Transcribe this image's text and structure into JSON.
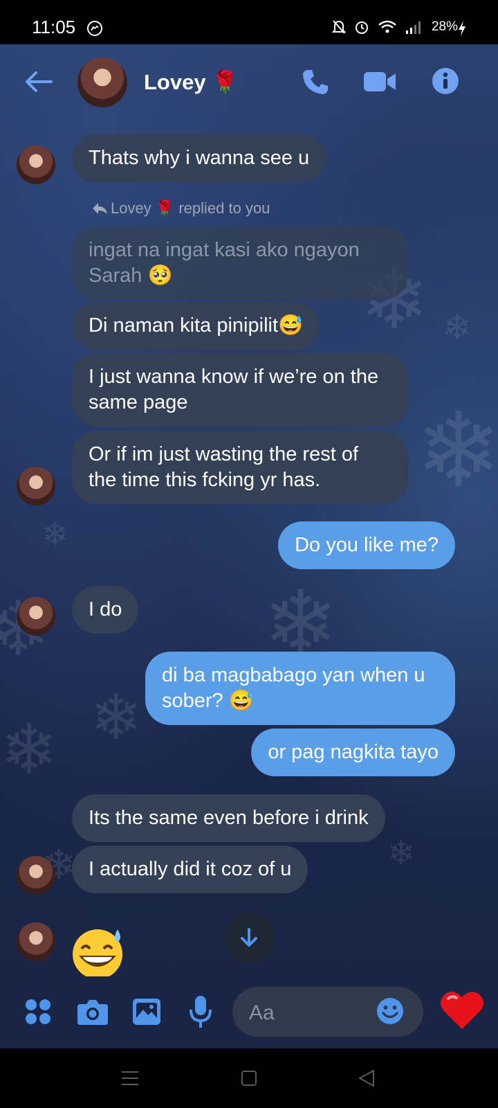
{
  "status": {
    "time": "11:05",
    "battery": "28%"
  },
  "header": {
    "name": "Lovey",
    "name_emoji": "🌹"
  },
  "reply_note": {
    "text": "Lovey 🌹 replied to you"
  },
  "messages": [
    {
      "side": "in",
      "text": "Thats why i wanna see u"
    },
    {
      "side": "quoted",
      "text": "ingat na ingat kasi ako ngayon Sarah 🥺"
    },
    {
      "side": "in",
      "text": "Di naman kita pinipilit😅"
    },
    {
      "side": "in",
      "text": "I just wanna know if we’re on the same page"
    },
    {
      "side": "in",
      "text": "Or if im just wasting the rest of the time this fcking yr has."
    },
    {
      "side": "out",
      "text": "Do you like me?"
    },
    {
      "side": "in",
      "text": "I do"
    },
    {
      "side": "out",
      "text": "di ba magbabago yan when u sober? 😅"
    },
    {
      "side": "out",
      "text": "or pag nagkita tayo"
    },
    {
      "side": "in",
      "text": "Its the same even before i drink"
    },
    {
      "side": "in",
      "text": "I actually did it coz of u"
    }
  ],
  "composer": {
    "placeholder": "Aa"
  },
  "icons": {
    "back": "arrow-left-icon",
    "call": "phone-icon",
    "video": "video-camera-icon",
    "info": "info-icon",
    "apps": "apps-grid-icon",
    "camera": "camera-icon",
    "gallery": "image-icon",
    "mic": "microphone-icon",
    "emoji": "smiley-icon",
    "like": "heart-icon",
    "scroll": "arrow-down-icon"
  },
  "colors": {
    "accent": "#5b9ee8",
    "incoming_bubble": "#334055",
    "outgoing_bubble": "#5b9ee8",
    "icon_blue": "#4f95ec"
  }
}
